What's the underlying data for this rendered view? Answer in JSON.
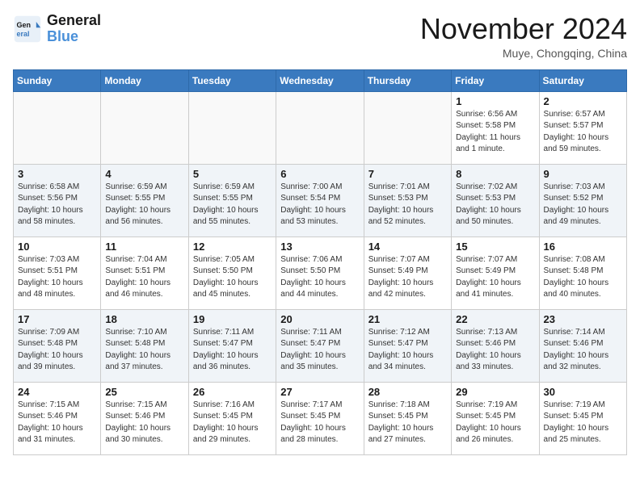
{
  "header": {
    "logo_line1": "General",
    "logo_line2": "Blue",
    "month": "November 2024",
    "location": "Muye, Chongqing, China"
  },
  "days_of_week": [
    "Sunday",
    "Monday",
    "Tuesday",
    "Wednesday",
    "Thursday",
    "Friday",
    "Saturday"
  ],
  "weeks": [
    [
      {
        "day": "",
        "info": ""
      },
      {
        "day": "",
        "info": ""
      },
      {
        "day": "",
        "info": ""
      },
      {
        "day": "",
        "info": ""
      },
      {
        "day": "",
        "info": ""
      },
      {
        "day": "1",
        "info": "Sunrise: 6:56 AM\nSunset: 5:58 PM\nDaylight: 11 hours and 1 minute."
      },
      {
        "day": "2",
        "info": "Sunrise: 6:57 AM\nSunset: 5:57 PM\nDaylight: 10 hours and 59 minutes."
      }
    ],
    [
      {
        "day": "3",
        "info": "Sunrise: 6:58 AM\nSunset: 5:56 PM\nDaylight: 10 hours and 58 minutes."
      },
      {
        "day": "4",
        "info": "Sunrise: 6:59 AM\nSunset: 5:55 PM\nDaylight: 10 hours and 56 minutes."
      },
      {
        "day": "5",
        "info": "Sunrise: 6:59 AM\nSunset: 5:55 PM\nDaylight: 10 hours and 55 minutes."
      },
      {
        "day": "6",
        "info": "Sunrise: 7:00 AM\nSunset: 5:54 PM\nDaylight: 10 hours and 53 minutes."
      },
      {
        "day": "7",
        "info": "Sunrise: 7:01 AM\nSunset: 5:53 PM\nDaylight: 10 hours and 52 minutes."
      },
      {
        "day": "8",
        "info": "Sunrise: 7:02 AM\nSunset: 5:53 PM\nDaylight: 10 hours and 50 minutes."
      },
      {
        "day": "9",
        "info": "Sunrise: 7:03 AM\nSunset: 5:52 PM\nDaylight: 10 hours and 49 minutes."
      }
    ],
    [
      {
        "day": "10",
        "info": "Sunrise: 7:03 AM\nSunset: 5:51 PM\nDaylight: 10 hours and 48 minutes."
      },
      {
        "day": "11",
        "info": "Sunrise: 7:04 AM\nSunset: 5:51 PM\nDaylight: 10 hours and 46 minutes."
      },
      {
        "day": "12",
        "info": "Sunrise: 7:05 AM\nSunset: 5:50 PM\nDaylight: 10 hours and 45 minutes."
      },
      {
        "day": "13",
        "info": "Sunrise: 7:06 AM\nSunset: 5:50 PM\nDaylight: 10 hours and 44 minutes."
      },
      {
        "day": "14",
        "info": "Sunrise: 7:07 AM\nSunset: 5:49 PM\nDaylight: 10 hours and 42 minutes."
      },
      {
        "day": "15",
        "info": "Sunrise: 7:07 AM\nSunset: 5:49 PM\nDaylight: 10 hours and 41 minutes."
      },
      {
        "day": "16",
        "info": "Sunrise: 7:08 AM\nSunset: 5:48 PM\nDaylight: 10 hours and 40 minutes."
      }
    ],
    [
      {
        "day": "17",
        "info": "Sunrise: 7:09 AM\nSunset: 5:48 PM\nDaylight: 10 hours and 39 minutes."
      },
      {
        "day": "18",
        "info": "Sunrise: 7:10 AM\nSunset: 5:48 PM\nDaylight: 10 hours and 37 minutes."
      },
      {
        "day": "19",
        "info": "Sunrise: 7:11 AM\nSunset: 5:47 PM\nDaylight: 10 hours and 36 minutes."
      },
      {
        "day": "20",
        "info": "Sunrise: 7:11 AM\nSunset: 5:47 PM\nDaylight: 10 hours and 35 minutes."
      },
      {
        "day": "21",
        "info": "Sunrise: 7:12 AM\nSunset: 5:47 PM\nDaylight: 10 hours and 34 minutes."
      },
      {
        "day": "22",
        "info": "Sunrise: 7:13 AM\nSunset: 5:46 PM\nDaylight: 10 hours and 33 minutes."
      },
      {
        "day": "23",
        "info": "Sunrise: 7:14 AM\nSunset: 5:46 PM\nDaylight: 10 hours and 32 minutes."
      }
    ],
    [
      {
        "day": "24",
        "info": "Sunrise: 7:15 AM\nSunset: 5:46 PM\nDaylight: 10 hours and 31 minutes."
      },
      {
        "day": "25",
        "info": "Sunrise: 7:15 AM\nSunset: 5:46 PM\nDaylight: 10 hours and 30 minutes."
      },
      {
        "day": "26",
        "info": "Sunrise: 7:16 AM\nSunset: 5:45 PM\nDaylight: 10 hours and 29 minutes."
      },
      {
        "day": "27",
        "info": "Sunrise: 7:17 AM\nSunset: 5:45 PM\nDaylight: 10 hours and 28 minutes."
      },
      {
        "day": "28",
        "info": "Sunrise: 7:18 AM\nSunset: 5:45 PM\nDaylight: 10 hours and 27 minutes."
      },
      {
        "day": "29",
        "info": "Sunrise: 7:19 AM\nSunset: 5:45 PM\nDaylight: 10 hours and 26 minutes."
      },
      {
        "day": "30",
        "info": "Sunrise: 7:19 AM\nSunset: 5:45 PM\nDaylight: 10 hours and 25 minutes."
      }
    ]
  ]
}
